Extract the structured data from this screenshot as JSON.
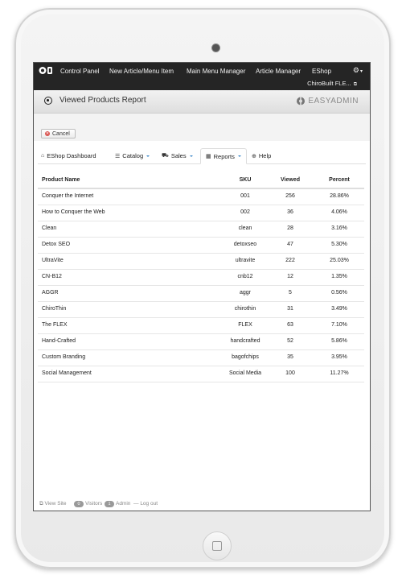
{
  "navbar": {
    "items": [
      {
        "label": "Control Panel"
      },
      {
        "label": "New Article/Menu Item"
      },
      {
        "label": "Main Menu Manager"
      },
      {
        "label": "Article Manager"
      },
      {
        "label": "EShop"
      }
    ],
    "site_name": "ChiroBuilt FLE...",
    "settings_caret": "▾"
  },
  "header": {
    "title": "Viewed Products Report",
    "brand": "EASYADMIN"
  },
  "toolbar": {
    "cancel_label": "Cancel"
  },
  "tabs": [
    {
      "label": "EShop Dashboard",
      "icon": "home-icon"
    },
    {
      "label": "Catalog",
      "icon": "list-icon",
      "dropdown": true
    },
    {
      "label": "Sales",
      "icon": "cart-icon",
      "dropdown": true
    },
    {
      "label": "Reports",
      "icon": "calendar-icon",
      "dropdown": true,
      "active": true
    },
    {
      "label": "Help",
      "icon": "globe-icon"
    }
  ],
  "table": {
    "columns": [
      "Product Name",
      "SKU",
      "Viewed",
      "Percent"
    ],
    "rows": [
      [
        "Conquer the Internet",
        "001",
        "256",
        "28.86%"
      ],
      [
        "How to Conquer the Web",
        "002",
        "36",
        "4.06%"
      ],
      [
        "Clean",
        "clean",
        "28",
        "3.16%"
      ],
      [
        "Detox SEO",
        "detoxseo",
        "47",
        "5.30%"
      ],
      [
        "UltraVite",
        "ultravite",
        "222",
        "25.03%"
      ],
      [
        "CN-B12",
        "cnb12",
        "12",
        "1.35%"
      ],
      [
        "AGGR",
        "aggr",
        "5",
        "0.56%"
      ],
      [
        "ChiroThin",
        "chirothin",
        "31",
        "3.49%"
      ],
      [
        "The FLEX",
        "FLEX",
        "63",
        "7.10%"
      ],
      [
        "Hand-Crafted",
        "handcrafted",
        "52",
        "5.86%"
      ],
      [
        "Custom Branding",
        "bagofchips",
        "35",
        "3.95%"
      ],
      [
        "Social Management",
        "Social Media",
        "100",
        "11.27%"
      ]
    ]
  },
  "footer": {
    "view_site": "View Site",
    "visitors_count": "0",
    "visitors_label": "Visitors",
    "admin_count": "1",
    "admin_label": "Admin",
    "logout": "Log out"
  }
}
